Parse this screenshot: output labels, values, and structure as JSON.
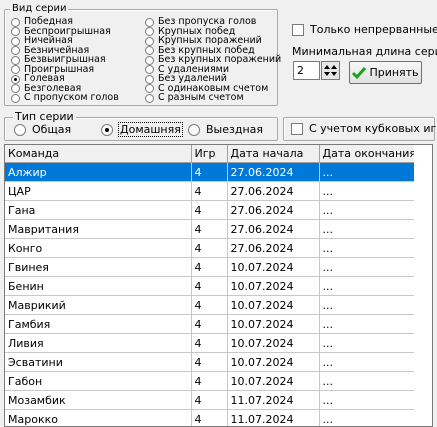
{
  "series_type_group": {
    "legend": "Вид серии",
    "col1": [
      {
        "label": "Победная",
        "checked": false
      },
      {
        "label": "Беспроигрышная",
        "checked": false
      },
      {
        "label": "Ничейная",
        "checked": false
      },
      {
        "label": "Безничейная",
        "checked": false
      },
      {
        "label": "Безвыигрышная",
        "checked": false
      },
      {
        "label": "Проигрышная",
        "checked": false
      },
      {
        "label": "Голевая",
        "checked": true
      },
      {
        "label": "Безголевая",
        "checked": false
      },
      {
        "label": "С пропуском голов",
        "checked": false
      }
    ],
    "col2": [
      {
        "label": "Без пропуска голов",
        "checked": false
      },
      {
        "label": "Крупных побед",
        "checked": false
      },
      {
        "label": "Крупных поражений",
        "checked": false
      },
      {
        "label": "Без крупных побед",
        "checked": false
      },
      {
        "label": "Без крупных поражений",
        "checked": false
      },
      {
        "label": "С удалениями",
        "checked": false
      },
      {
        "label": "Без удалений",
        "checked": false
      },
      {
        "label": "С одинаковым счетом",
        "checked": false
      },
      {
        "label": "С разным счетом",
        "checked": false
      }
    ]
  },
  "only_continuous": {
    "label": "Только непрерванные",
    "checked": false
  },
  "min_length": {
    "label": "Минимальная длина серии",
    "value": "2"
  },
  "apply_button": {
    "label": "Принять"
  },
  "venue_group": {
    "legend": "Тип серии",
    "options": [
      {
        "label": "Общая",
        "checked": false
      },
      {
        "label": "Домашняя",
        "checked": true
      },
      {
        "label": "Выездная",
        "checked": false
      }
    ]
  },
  "cup_games": {
    "label": "С учетом кубковых игр",
    "checked": false
  },
  "table": {
    "columns": [
      "Команда",
      "Игр",
      "Дата начала",
      "Дата окончания"
    ],
    "rows": [
      [
        "Алжир",
        "4",
        "27.06.2024",
        "..."
      ],
      [
        "ЦАР",
        "4",
        "27.06.2024",
        "..."
      ],
      [
        "Гана",
        "4",
        "27.06.2024",
        "..."
      ],
      [
        "Мавритания",
        "4",
        "27.06.2024",
        "..."
      ],
      [
        "Конго",
        "4",
        "27.06.2024",
        "..."
      ],
      [
        "Гвинея",
        "4",
        "10.07.2024",
        "..."
      ],
      [
        "Бенин",
        "4",
        "10.07.2024",
        "..."
      ],
      [
        "Маврикий",
        "4",
        "10.07.2024",
        "..."
      ],
      [
        "Гамбия",
        "4",
        "10.07.2024",
        "..."
      ],
      [
        "Ливия",
        "4",
        "10.07.2024",
        "..."
      ],
      [
        "Эсватини",
        "4",
        "10.07.2024",
        "..."
      ],
      [
        "Габон",
        "4",
        "10.07.2024",
        "..."
      ],
      [
        "Мозамбик",
        "4",
        "11.07.2024",
        "..."
      ],
      [
        "Марокко",
        "4",
        "11.07.2024",
        "..."
      ]
    ],
    "selected_row": 0
  },
  "colors": {
    "selection": "#0078d7",
    "apply_icon": "#1e9e1e"
  }
}
